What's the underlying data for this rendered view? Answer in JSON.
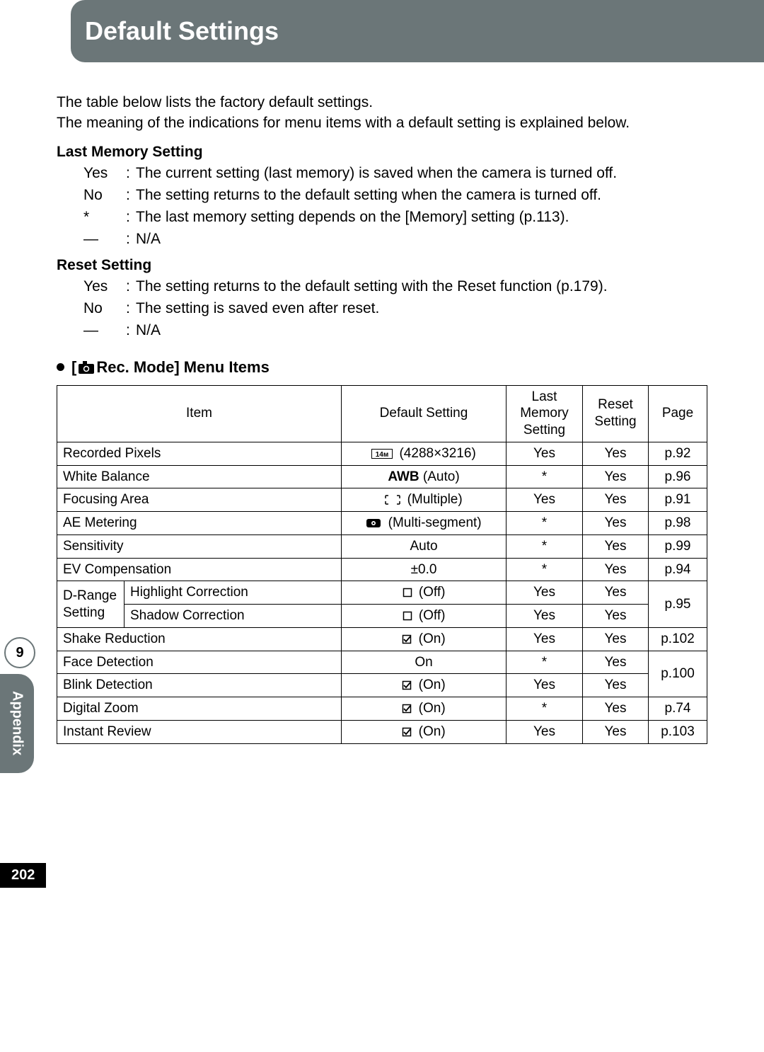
{
  "header": {
    "title": "Default Settings"
  },
  "intro": {
    "line1": "The table below lists the factory default settings.",
    "line2": "The meaning of the indications for menu items with a default setting is explained below."
  },
  "sections": {
    "lastMemory": {
      "title": "Last Memory Setting",
      "rows": {
        "yes": {
          "key": "Yes",
          "val": "The current setting (last memory) is saved when the camera is turned off."
        },
        "no": {
          "key": "No",
          "val": "The setting returns to the default setting when the camera is turned off."
        },
        "star": {
          "key": "*",
          "val": "The last memory setting depends on the [Memory] setting (p.113)."
        },
        "dash": {
          "key": "—",
          "val": "N/A"
        }
      }
    },
    "reset": {
      "title": "Reset Setting",
      "rows": {
        "yes": {
          "key": "Yes",
          "val": "The setting returns to the default setting with the Reset function (p.179)."
        },
        "no": {
          "key": "No",
          "val": "The setting is saved even after reset."
        },
        "dash": {
          "key": "—",
          "val": "N/A"
        }
      }
    }
  },
  "menu": {
    "header_prefix": "[",
    "header_text": " Rec. Mode] Menu Items",
    "columns": {
      "item": "Item",
      "default": "Default Setting",
      "last": "Last\nMemory\nSetting",
      "reset": "Reset\nSetting",
      "page": "Page"
    },
    "rows": {
      "recPixels": {
        "item": "Recorded Pixels",
        "default_icon": "14m-icon",
        "default_text": "(4288×3216)",
        "last": "Yes",
        "reset": "Yes",
        "page": "p.92"
      },
      "whiteBal": {
        "item": "White Balance",
        "default_bold": "AWB",
        "default_text": " (Auto)",
        "last": "*",
        "reset": "Yes",
        "page": "p.96"
      },
      "focusArea": {
        "item": "Focusing Area",
        "default_icon": "focus-multi-icon",
        "default_text": "(Multiple)",
        "last": "Yes",
        "reset": "Yes",
        "page": "p.91"
      },
      "aeMeter": {
        "item": "AE Metering",
        "default_icon": "multiseg-icon",
        "default_text": "(Multi-segment)",
        "last": "*",
        "reset": "Yes",
        "page": "p.98"
      },
      "sensitivity": {
        "item": "Sensitivity",
        "default_text": "Auto",
        "last": "*",
        "reset": "Yes",
        "page": "p.99"
      },
      "evComp": {
        "item": "EV Compensation",
        "default_text": "±0.0",
        "last": "*",
        "reset": "Yes",
        "page": "p.94"
      },
      "drange": {
        "group_label": "D-Range Setting",
        "hl": {
          "label": "Highlight Correction",
          "default_icon": "unchecked-icon",
          "default_text": "(Off)",
          "last": "Yes",
          "reset": "Yes"
        },
        "sh": {
          "label": "Shadow Correction",
          "default_icon": "unchecked-icon",
          "default_text": "(Off)",
          "last": "Yes",
          "reset": "Yes"
        },
        "page": "p.95"
      },
      "shake": {
        "item": "Shake Reduction",
        "default_icon": "checked-icon",
        "default_text": "(On)",
        "last": "Yes",
        "reset": "Yes",
        "page": "p.102"
      },
      "face": {
        "item": "Face Detection",
        "default_text": "On",
        "last": "*",
        "reset": "Yes",
        "page": "p.100"
      },
      "blink": {
        "item": "Blink Detection",
        "default_icon": "checked-icon",
        "default_text": "(On)",
        "last": "Yes",
        "reset": "Yes"
      },
      "digZoom": {
        "item": "Digital Zoom",
        "default_icon": "checked-icon",
        "default_text": "(On)",
        "last": "*",
        "reset": "Yes",
        "page": "p.74"
      },
      "instReview": {
        "item": "Instant Review",
        "default_icon": "checked-icon",
        "default_text": "(On)",
        "last": "Yes",
        "reset": "Yes",
        "page": "p.103"
      }
    }
  },
  "sidebar": {
    "chapter_num": "9",
    "chapter_name": "Appendix"
  },
  "footer": {
    "page_number": "202"
  }
}
